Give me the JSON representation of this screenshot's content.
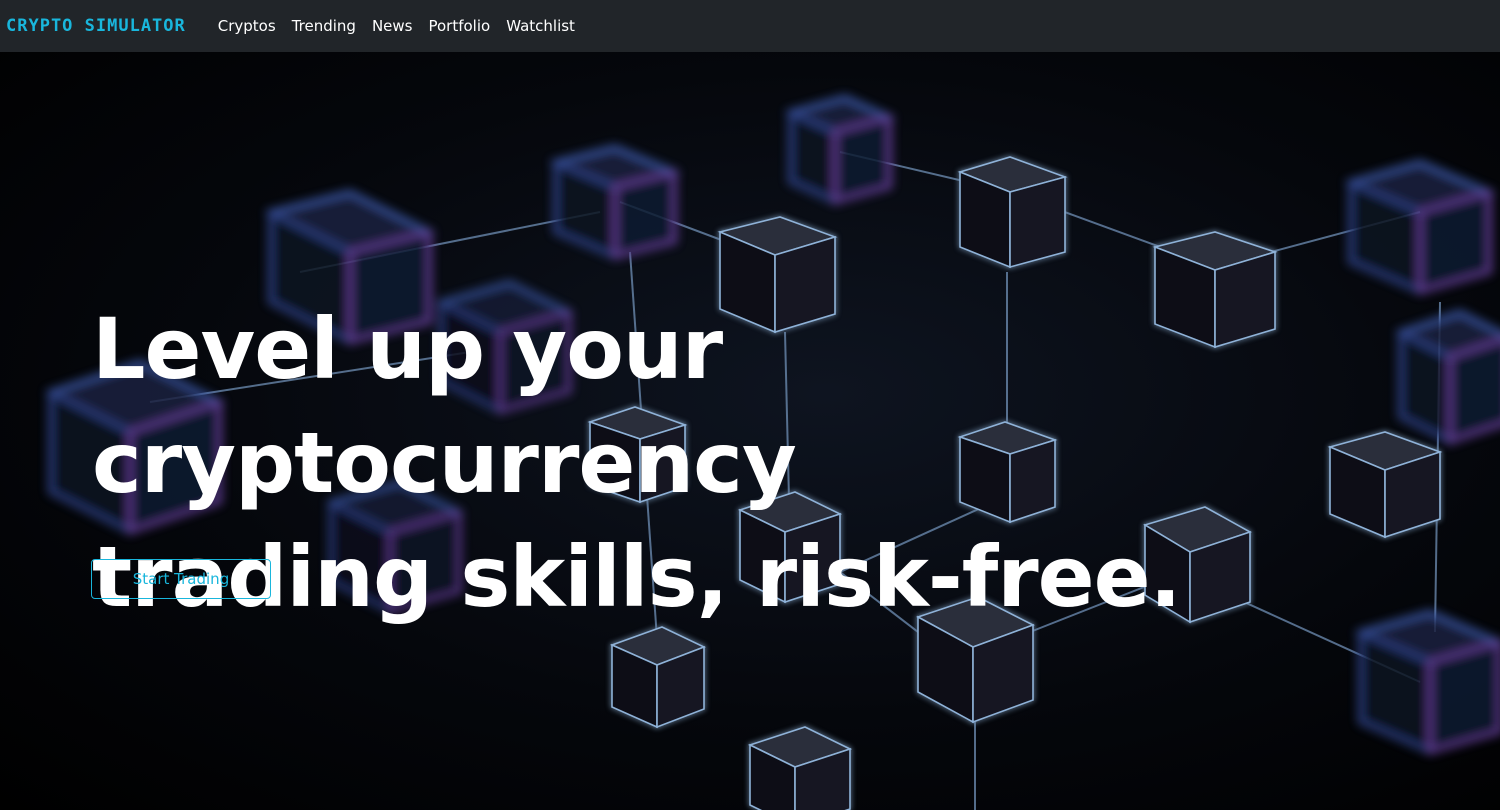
{
  "navbar": {
    "brand": "CRYPTO SIMULATOR",
    "links": [
      "Cryptos",
      "Trending",
      "News",
      "Portfolio",
      "Watchlist"
    ]
  },
  "hero": {
    "title_line1": "Level up your cryptocurrency",
    "title_line2": "trading skills, risk-free.",
    "cta_label": "Start Trading",
    "background_image": "blockchain-cubes-network"
  },
  "colors": {
    "navbar_bg": "#212529",
    "accent": "#19b6dc",
    "hero_text": "#ffffff"
  }
}
